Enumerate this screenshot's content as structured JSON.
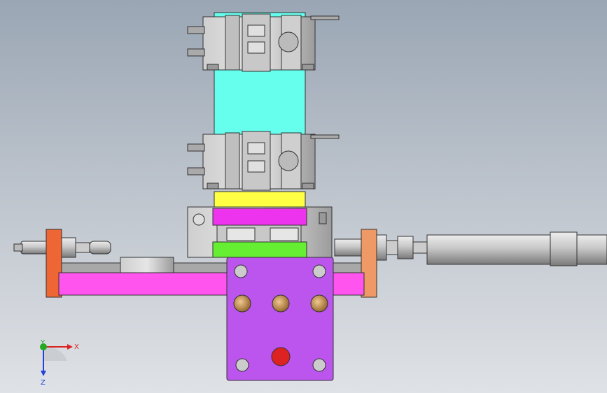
{
  "viewport": {
    "background_top": "#9aa6b4",
    "background_bottom": "#dfe2e6"
  },
  "colors": {
    "cyan_block": "#66ffee",
    "yellow_block": "#ffff44",
    "magenta_block": "#ee33ee",
    "green_block": "#66ee33",
    "pink_rail": "#ff55ee",
    "purple_plate": "#bb55ee",
    "orange_end_left": "#ee6633",
    "orange_end_right": "#ee9966",
    "gray_metal": "#a8a8a8",
    "dark_edge": "#333333",
    "brass_screw": "#cc9955",
    "red_button": "#dd2222"
  },
  "icons": {
    "triad": "coordinate-triad-icon"
  },
  "axes": {
    "x_label": "X",
    "y_label": "Y",
    "z_label": "Z",
    "x_color": "#dd2222",
    "y_color": "#22aa22",
    "z_color": "#2244dd"
  }
}
